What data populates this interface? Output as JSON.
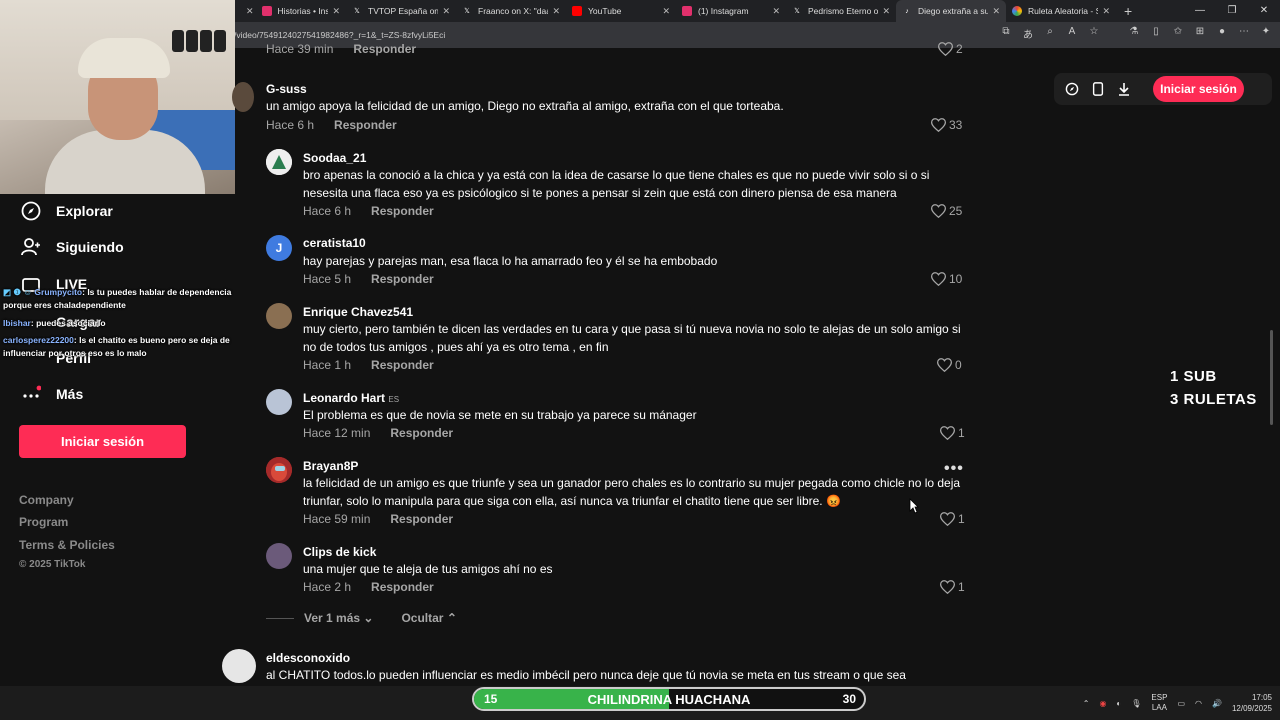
{
  "browser": {
    "tabs": [
      {
        "title": "Historias • Instagra",
        "icon": "instagram-icon",
        "color": "#e1306c"
      },
      {
        "title": "TVTOP España on X",
        "icon": "x-icon",
        "color": "#000000"
      },
      {
        "title": "Fraanco on X: \"daa",
        "icon": "x-icon",
        "color": "#000000"
      },
      {
        "title": "YouTube",
        "icon": "youtube-icon",
        "color": "#ff0000"
      },
      {
        "title": "(1) Instagram",
        "icon": "instagram-icon",
        "color": "#e1306c"
      },
      {
        "title": "Pedrismo Eterno on",
        "icon": "x-icon",
        "color": "#000000"
      },
      {
        "title": "Diego extraña a su",
        "icon": "tiktok-icon",
        "color": "#000000"
      },
      {
        "title": "Ruleta Aleatoria - S",
        "icon": "wheel-icon",
        "color": "#4285f4"
      }
    ],
    "url": "/video/7549124027541982486?_r=1&_t=ZS-8zfvyLi5Eci"
  },
  "sidebar": {
    "items": [
      {
        "label": "Explorar",
        "icon": "compass-icon"
      },
      {
        "label": "Siguiendo",
        "icon": "following-icon"
      },
      {
        "label": "LIVE",
        "icon": "live-icon"
      },
      {
        "label": "Cargar",
        "icon": "upload-icon"
      },
      {
        "label": "Perfil",
        "icon": "profile-icon"
      },
      {
        "label": "Más",
        "icon": "more-icon"
      }
    ],
    "login": "Iniciar sesión",
    "footer": [
      "Company",
      "Program",
      "Terms & Policies"
    ],
    "copyright": "© 2025 TikTok"
  },
  "chat": [
    {
      "user": "Grumpycito",
      "text": ": Is tu puedes hablar de dependencia porque eres chaladependiente"
    },
    {
      "user": "Ibishar",
      "text": ": puedes asociarlo"
    },
    {
      "user": "carlosperez22200",
      "text": ": Is el chatito es bueno pero se deja de influenciar por otros eso es lo malo"
    }
  ],
  "comments_top_partial": {
    "time": "Hace 39 min",
    "reply": "Responder",
    "likes": "2"
  },
  "comments": [
    {
      "user": "G-suss",
      "text": "un amigo apoya la felicidad de un amigo, Diego no extraña al amigo, extraña con el que torteaba.",
      "time": "Hace 6 h",
      "reply": "Responder",
      "likes": "33"
    },
    {
      "user": "Soodaa_21",
      "text": "bro apenas la conoció a la chica y ya está con la idea de casarse lo que tiene chales es que no puede vivir solo si o si nesesita una flaca eso ya es psicólogico si te pones a pensar si zein que está con dinero piensa de esa manera",
      "time": "Hace 6 h",
      "reply": "Responder",
      "likes": "25"
    },
    {
      "user": "ceratista10",
      "text": "hay parejas y parejas man, esa flaca lo ha amarrado feo y él se ha embobado",
      "time": "Hace 5 h",
      "reply": "Responder",
      "likes": "10"
    },
    {
      "user": "Enrique Chavez541",
      "text": "muy cierto, pero también te dicen las verdades en tu cara y que pasa si tú nueva novia no solo te alejas de un solo amigo si no de todos tus amigos , pues ahí ya es otro tema , en fin",
      "time": "Hace 1 h",
      "reply": "Responder",
      "likes": "0"
    },
    {
      "user": "Leonardo Hart",
      "tag": "ES",
      "text": "El problema es que de novia se mete en su trabajo ya parece su mánager",
      "time": "Hace 12 min",
      "reply": "Responder",
      "likes": "1"
    },
    {
      "user": "Brayan8P",
      "text": "la felicidad de un amigo es que triunfe y sea un ganador pero chales es lo contrario su mujer pegada como chicle no lo deja triunfar, solo lo manipula para que siga con ella, así nunca va triunfar el chatito tiene que ser libre. 😡",
      "time": "Hace 59 min",
      "reply": "Responder",
      "likes": "1"
    },
    {
      "user": "Clips de kick",
      "text": "una mujer que te aleja de tus amigos ahí no es",
      "time": "Hace 2 h",
      "reply": "Responder",
      "likes": "1"
    }
  ],
  "more": {
    "view_more": "Ver 1 más",
    "hide": "Ocultar"
  },
  "last_comment": {
    "user": "eldesconoxido",
    "text": "al CHATITO todos.lo pueden influenciar es medio imbécil pero nunca deje que tú novia se meta en tus stream o que sea"
  },
  "top_actions": {
    "login": "Iniciar sesión"
  },
  "overlay": {
    "line1": "1 SUB",
    "line2": "3 RULETAS"
  },
  "goal": {
    "current": "15",
    "label": "CHILINDRINA HUACHANA",
    "target": "30",
    "progress": 0.5
  },
  "tray": {
    "lang1": "ESP",
    "lang2": "LAA",
    "time": "17:05",
    "date": "12/09/2025"
  },
  "colors": {
    "accent": "#fe2c55",
    "bg": "#121212"
  }
}
